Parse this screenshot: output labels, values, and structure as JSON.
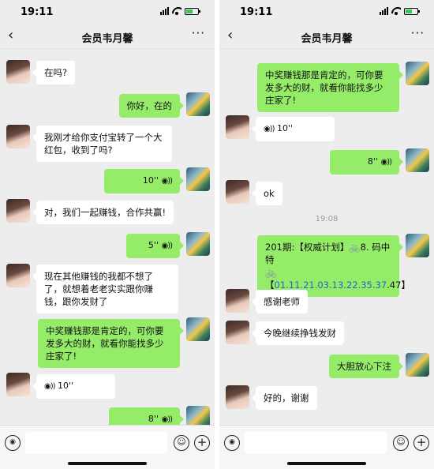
{
  "status_bar": {
    "time": "19:11"
  },
  "header": {
    "back_icon": "‹",
    "title": "会员韦月馨",
    "more_icon": "···"
  },
  "voice_icon_glyph": "◉))",
  "left": {
    "messages": [
      {
        "from": "contact",
        "text": "在吗?"
      },
      {
        "from": "me",
        "text": "你好，在的"
      },
      {
        "from": "contact",
        "text": "我刚才给你支付宝转了一个大红包，收到了吗?"
      },
      {
        "from": "me",
        "voice": "10''"
      },
      {
        "from": "contact",
        "text": "对，我们一起赚钱，合作共赢!"
      },
      {
        "from": "me",
        "voice": "5''"
      },
      {
        "from": "contact",
        "text": "现在其他赚钱的我都不想了了，就想着老老实实跟你赚钱，跟你发财了"
      },
      {
        "from": "me",
        "text": "中奖赚钱那是肯定的，可你要发多大的财，就看你能找多少庄家了!"
      },
      {
        "from": "contact",
        "voice": "10''"
      },
      {
        "from": "me",
        "voice": "8''"
      }
    ]
  },
  "right": {
    "timestamp": "19:08",
    "messages": [
      {
        "from": "me",
        "text": "中奖赚钱那是肯定的，可你要发多大的财，就看你能找多少庄家了!"
      },
      {
        "from": "contact",
        "voice": "10''"
      },
      {
        "from": "me",
        "voice": "8''"
      },
      {
        "from": "contact",
        "text": "ok"
      },
      {
        "from": "me",
        "lottery": {
          "part1": "201期:【权威计划】",
          "bike1": "🚲",
          "part2": "8. 码中特",
          "bike2": "🚲",
          "bracket_open": "【",
          "numbers": "01.11.21.03.13.22.35.37",
          "tail": ".47】"
        }
      },
      {
        "from": "contact",
        "text": "感谢老师"
      },
      {
        "from": "contact",
        "text": "今晚继续挣钱发财"
      },
      {
        "from": "me",
        "text": "大胆放心下注"
      },
      {
        "from": "contact",
        "text": "好的，谢谢"
      }
    ]
  },
  "input_bar": {
    "voice_icon": "◉",
    "emoji_icon": "☺",
    "plus_icon": "+"
  }
}
